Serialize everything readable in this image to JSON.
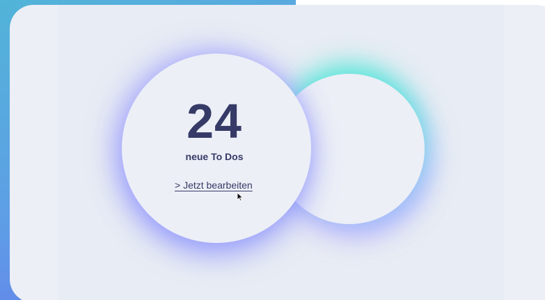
{
  "widget": {
    "count": "24",
    "subtitle": "neue To Dos",
    "link_label": "> Jetzt bearbeiten"
  },
  "colors": {
    "text": "#363a66",
    "card_bg": "#eceff5",
    "glow_cyan": "#40e8d4",
    "glow_violet": "#6e78ff"
  },
  "icons": {
    "cursor": "mouse-pointer-icon"
  }
}
